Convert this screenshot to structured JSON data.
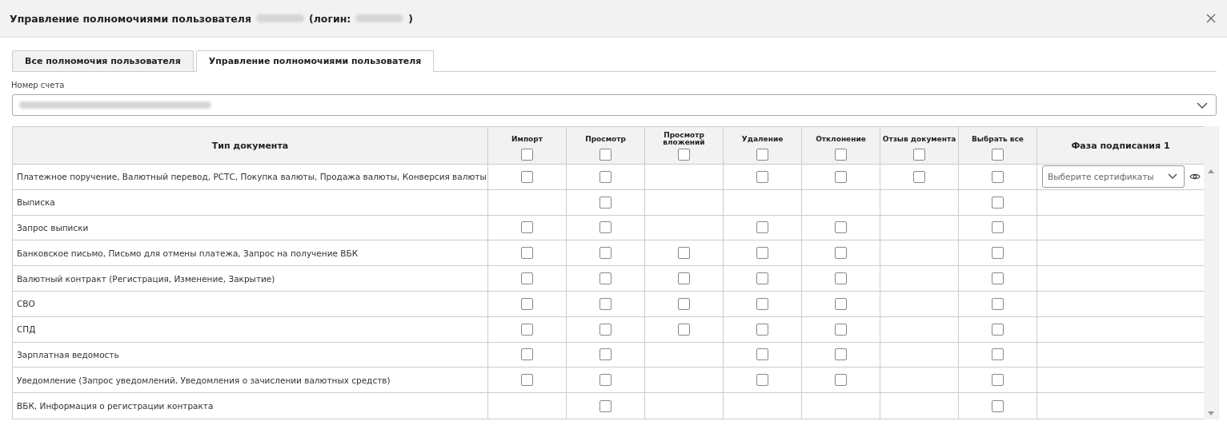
{
  "dialog": {
    "title": "Управление полномочиями пользователя",
    "login_label": "(логин:",
    "login_end": ")"
  },
  "tabs": [
    {
      "label": "Все полномочия пользователя",
      "selected": false
    },
    {
      "label": "Управление полномочиями пользователя",
      "selected": true
    }
  ],
  "account": {
    "label": "Номер счета"
  },
  "table": {
    "columns": [
      {
        "label": "Тип документа",
        "kind": "text"
      },
      {
        "label": "Импорт",
        "kind": "check",
        "checked": false
      },
      {
        "label": "Просмотр",
        "kind": "check",
        "checked": false
      },
      {
        "label": "Просмотр вложений",
        "kind": "check",
        "checked": false
      },
      {
        "label": "Удаление",
        "kind": "check",
        "checked": false
      },
      {
        "label": "Отклонение",
        "kind": "check",
        "checked": false
      },
      {
        "label": "Отзыв документа",
        "kind": "check",
        "checked": false
      },
      {
        "label": "Выбрать все",
        "kind": "check",
        "checked": false
      },
      {
        "label": "Фаза подписания 1",
        "kind": "phase"
      }
    ],
    "rows": [
      {
        "type": "Платежное поручение, Валютный перевод, РСТС, Покупка валюты, Продажа валюты, Конверсия валюты",
        "permissions": [
          {
            "available": true,
            "checked": false
          },
          {
            "available": true,
            "checked": false
          },
          {
            "available": false
          },
          {
            "available": true,
            "checked": false
          },
          {
            "available": true,
            "checked": false
          },
          {
            "available": true,
            "checked": false
          },
          {
            "available": true,
            "checked": false
          }
        ],
        "phase": {
          "placeholder": "Выберите сертификаты"
        }
      },
      {
        "type": "Выписка",
        "permissions": [
          {
            "available": false
          },
          {
            "available": true,
            "checked": false
          },
          {
            "available": false
          },
          {
            "available": false
          },
          {
            "available": false
          },
          {
            "available": false
          },
          {
            "available": true,
            "checked": false
          }
        ]
      },
      {
        "type": "Запрос выписки",
        "permissions": [
          {
            "available": true,
            "checked": false
          },
          {
            "available": true,
            "checked": false
          },
          {
            "available": false
          },
          {
            "available": true,
            "checked": false
          },
          {
            "available": true,
            "checked": false
          },
          {
            "available": false
          },
          {
            "available": true,
            "checked": false
          }
        ]
      },
      {
        "type": "Банковское письмо, Письмо для отмены платежа, Запрос на получение ВБК",
        "permissions": [
          {
            "available": true,
            "checked": false
          },
          {
            "available": true,
            "checked": false
          },
          {
            "available": true,
            "checked": false
          },
          {
            "available": true,
            "checked": false
          },
          {
            "available": true,
            "checked": false
          },
          {
            "available": false
          },
          {
            "available": true,
            "checked": false
          }
        ]
      },
      {
        "type": "Валютный контракт (Регистрация, Изменение, Закрытие)",
        "permissions": [
          {
            "available": true,
            "checked": false
          },
          {
            "available": true,
            "checked": false
          },
          {
            "available": true,
            "checked": false
          },
          {
            "available": true,
            "checked": false
          },
          {
            "available": true,
            "checked": false
          },
          {
            "available": false
          },
          {
            "available": true,
            "checked": false
          }
        ]
      },
      {
        "type": "СВО",
        "permissions": [
          {
            "available": true,
            "checked": false
          },
          {
            "available": true,
            "checked": false
          },
          {
            "available": true,
            "checked": false
          },
          {
            "available": true,
            "checked": false
          },
          {
            "available": true,
            "checked": false
          },
          {
            "available": false
          },
          {
            "available": true,
            "checked": false
          }
        ]
      },
      {
        "type": "СПД",
        "permissions": [
          {
            "available": true,
            "checked": false
          },
          {
            "available": true,
            "checked": false
          },
          {
            "available": true,
            "checked": false
          },
          {
            "available": true,
            "checked": false
          },
          {
            "available": true,
            "checked": false
          },
          {
            "available": false
          },
          {
            "available": true,
            "checked": false
          }
        ]
      },
      {
        "type": "Зарплатная ведомость",
        "permissions": [
          {
            "available": true,
            "checked": false
          },
          {
            "available": true,
            "checked": false
          },
          {
            "available": false
          },
          {
            "available": true,
            "checked": false
          },
          {
            "available": true,
            "checked": false
          },
          {
            "available": false
          },
          {
            "available": true,
            "checked": false
          }
        ]
      },
      {
        "type": "Уведомление (Запрос уведомлений, Уведомления о зачислении валютных средств)",
        "permissions": [
          {
            "available": true,
            "checked": false
          },
          {
            "available": true,
            "checked": false
          },
          {
            "available": false
          },
          {
            "available": true,
            "checked": false
          },
          {
            "available": true,
            "checked": false
          },
          {
            "available": false
          },
          {
            "available": true,
            "checked": false
          }
        ]
      },
      {
        "type": "ВБК, Информация о регистрации контракта",
        "permissions": [
          {
            "available": false
          },
          {
            "available": true,
            "checked": false
          },
          {
            "available": false
          },
          {
            "available": false
          },
          {
            "available": false
          },
          {
            "available": false
          },
          {
            "available": true,
            "checked": false
          }
        ]
      }
    ]
  }
}
